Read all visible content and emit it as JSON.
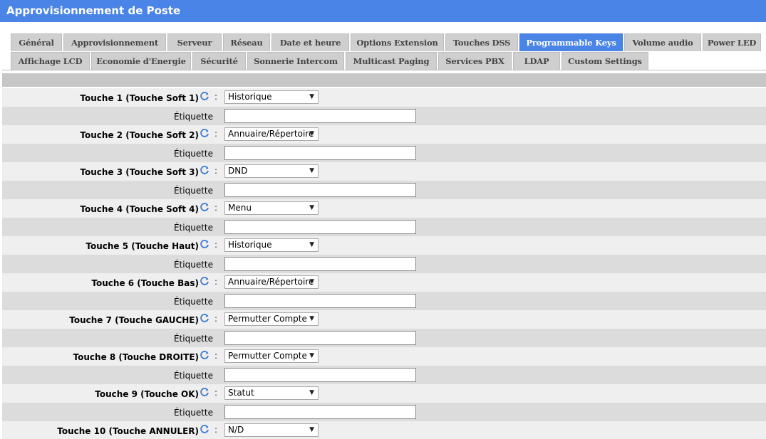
{
  "header": {
    "title": "Approvisionnement de Poste"
  },
  "tabs_row1": [
    {
      "label": "Général"
    },
    {
      "label": "Approvisionnement"
    },
    {
      "label": "Serveur"
    },
    {
      "label": "Réseau"
    },
    {
      "label": "Date et heure"
    },
    {
      "label": "Options Extension"
    },
    {
      "label": "Touches DSS"
    },
    {
      "label": "Programmable Keys",
      "active": true
    },
    {
      "label": "Volume audio"
    },
    {
      "label": "Power LED"
    }
  ],
  "tabs_row2": [
    {
      "label": "Affichage LCD"
    },
    {
      "label": "Economie d'Energie"
    },
    {
      "label": "Sécurité"
    },
    {
      "label": "Sonnerie Intercom"
    },
    {
      "label": "Multicast Paging"
    },
    {
      "label": "Services PBX"
    },
    {
      "label": "LDAP"
    },
    {
      "label": "Custom Settings"
    }
  ],
  "form": {
    "colon": ":",
    "label_text": "Étiquette",
    "keys": [
      {
        "name": "Touche 1 (Touche Soft 1)",
        "value": "Historique",
        "label_value": ""
      },
      {
        "name": "Touche 2 (Touche Soft 2)",
        "value": "Annuaire/Répertoire",
        "label_value": ""
      },
      {
        "name": "Touche 3 (Touche Soft 3)",
        "value": "DND",
        "label_value": ""
      },
      {
        "name": "Touche 4 (Touche Soft 4)",
        "value": "Menu",
        "label_value": ""
      },
      {
        "name": "Touche 5 (Touche Haut)",
        "value": "Historique",
        "label_value": ""
      },
      {
        "name": "Touche 6 (Touche Bas)",
        "value": "Annuaire/Répertoire",
        "label_value": ""
      },
      {
        "name": "Touche 7 (Touche GAUCHE)",
        "value": "Permutter Compte",
        "label_value": ""
      },
      {
        "name": "Touche 8 (Touche DROITE)",
        "value": "Permutter Compte",
        "label_value": ""
      },
      {
        "name": "Touche 9 (Touche OK)",
        "value": "Statut",
        "label_value": ""
      },
      {
        "name": "Touche 10 (Touche ANNULER)",
        "value": "N/D",
        "label_value": ""
      }
    ]
  },
  "icons": {
    "refresh": "refresh-icon",
    "dropdown": "chevron-down-icon"
  },
  "colors": {
    "accent": "#4a84e6",
    "tab_inactive": "#cfcfcf",
    "row_light": "#efefef",
    "row_dark": "#dcdcdc"
  }
}
